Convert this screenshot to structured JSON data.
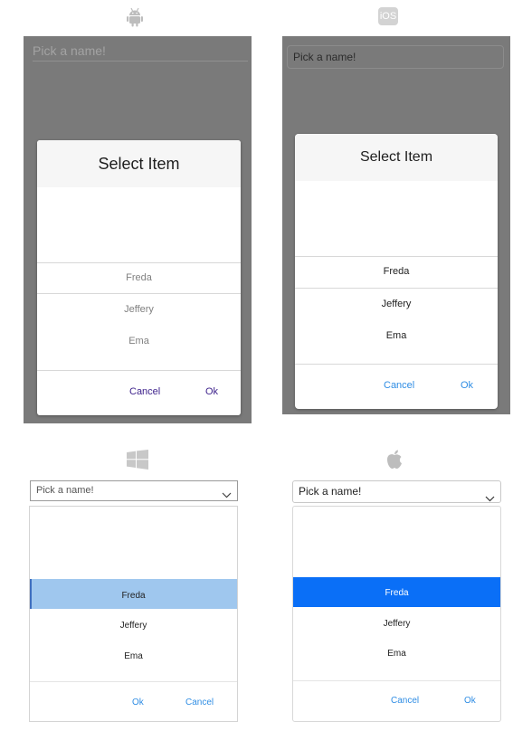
{
  "android": {
    "platform_icon": "android-icon",
    "picker_placeholder": "Pick a name!",
    "dialog_title": "Select Item",
    "items": [
      "Freda",
      "Jeffery",
      "Ema"
    ],
    "cancel": "Cancel",
    "ok": "Ok"
  },
  "ios": {
    "platform_icon": "ios-icon",
    "icon_text": "iOS",
    "picker_placeholder": "Pick a name!",
    "dialog_title": "Select Item",
    "items": [
      "Freda",
      "Jeffery",
      "Ema"
    ],
    "cancel": "Cancel",
    "ok": "Ok"
  },
  "windows": {
    "platform_icon": "windows-icon",
    "picker_placeholder": "Pick a name!",
    "items": [
      "Freda",
      "Jeffery",
      "Ema"
    ],
    "selected": "Freda",
    "ok": "Ok",
    "cancel": "Cancel"
  },
  "mac": {
    "platform_icon": "apple-icon",
    "picker_placeholder": "Pick a name!",
    "items": [
      "Freda",
      "Jeffery",
      "Ema"
    ],
    "selected": "Freda",
    "cancel": "Cancel",
    "ok": "Ok"
  },
  "colors": {
    "modal_overlay": "#7a7a7a",
    "android_button": "#3b1f8a",
    "ios_button": "#2f8de4",
    "windows_selection": "#9fc7ee",
    "mac_selection": "#0a6ff7"
  }
}
